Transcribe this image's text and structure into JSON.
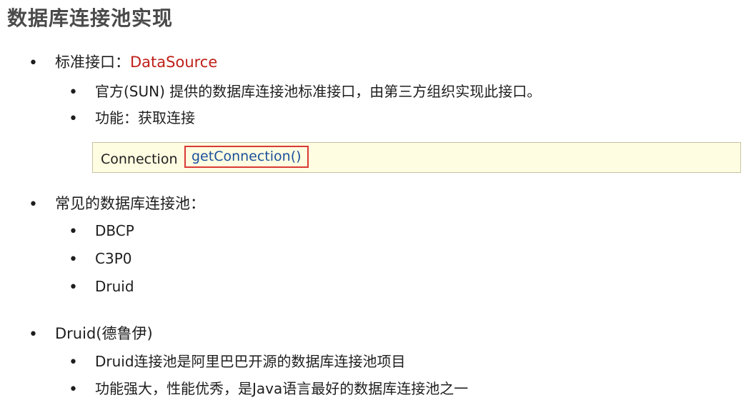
{
  "title": "数据库连接池实现",
  "items": [
    {
      "prefix": "标准接口：",
      "highlight": "DataSource",
      "children": [
        "官方(SUN) 提供的数据库连接池标准接口，由第三方组织实现此接口。",
        "功能：获取连接"
      ]
    },
    {
      "text": "常见的数据库连接池：",
      "children": [
        "DBCP",
        "C3P0",
        "Druid"
      ]
    },
    {
      "text": "Druid(德鲁伊)",
      "children": [
        "Druid连接池是阿里巴巴开源的数据库连接池项目",
        "功能强大，性能优秀，是Java语言最好的数据库连接池之一"
      ]
    }
  ],
  "code": {
    "type": "Connection",
    "method": "getConnection()"
  },
  "colors": {
    "highlight": "#c0201a",
    "method": "#1a4f9c",
    "box_background": "#fffde1",
    "box_border": "#d83a34"
  }
}
